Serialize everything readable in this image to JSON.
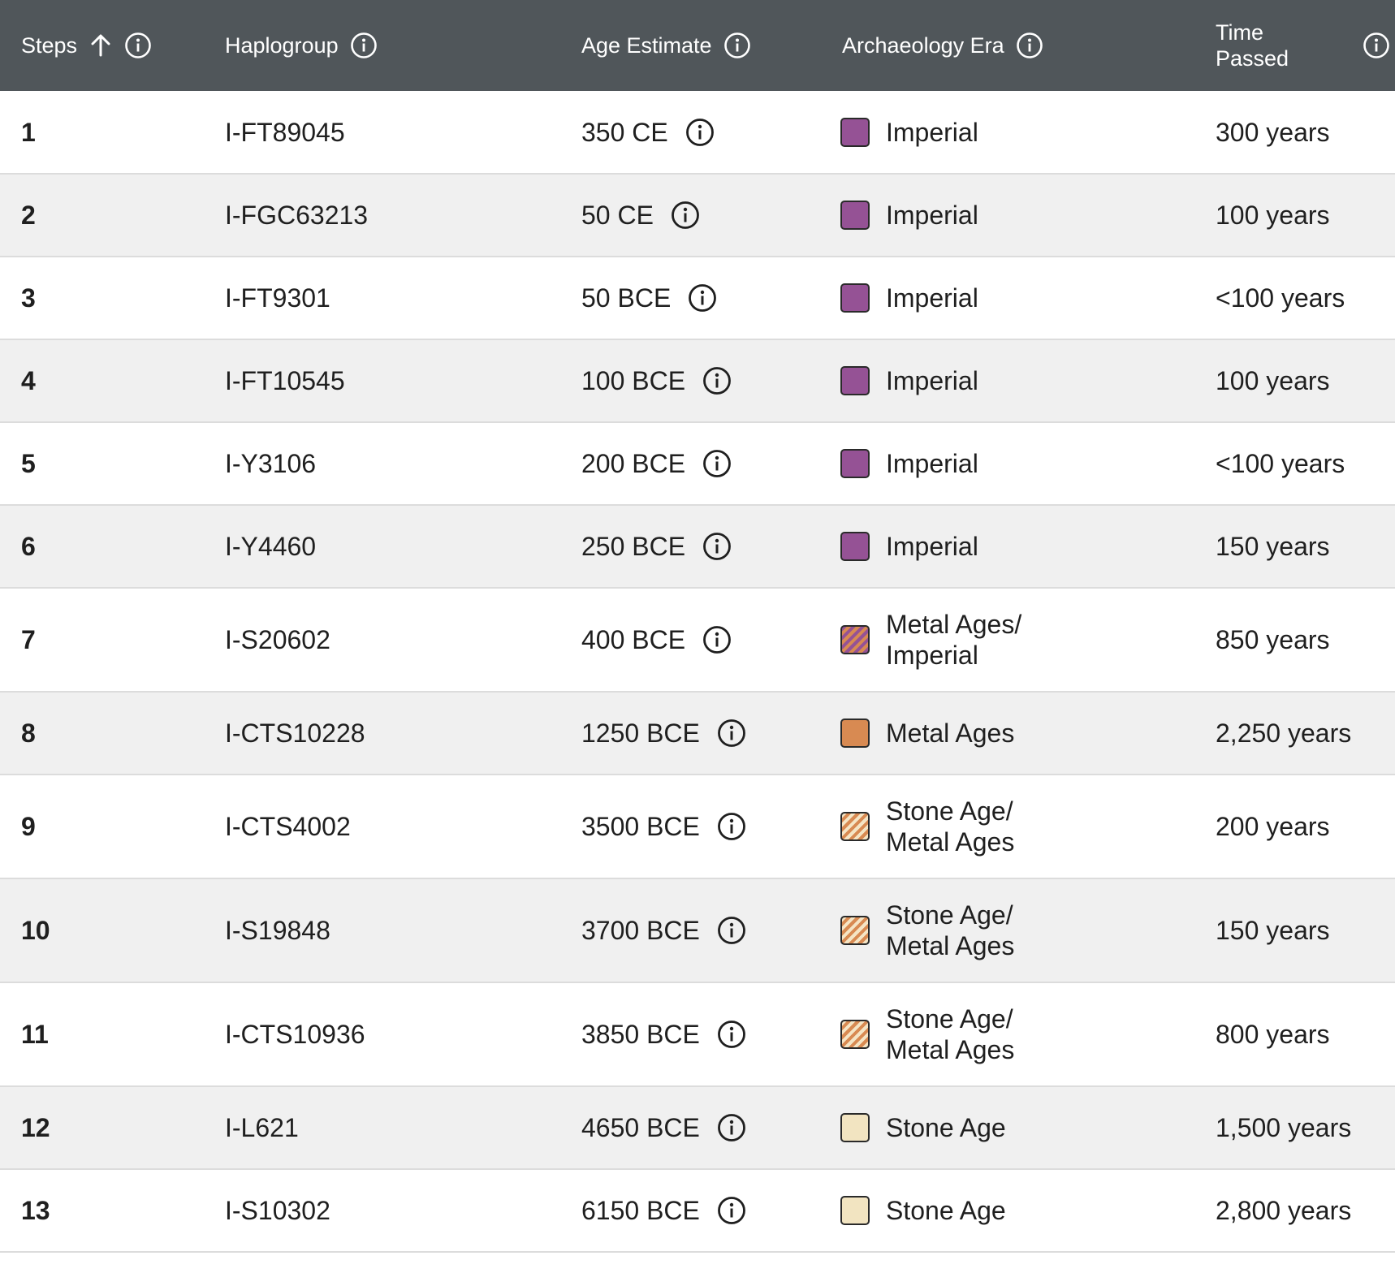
{
  "header": {
    "steps": "Steps",
    "haplogroup": "Haplogroup",
    "age_estimate": "Age Estimate",
    "archaeology_era": "Archaeology Era",
    "time_passed": "Time Passed"
  },
  "rows": [
    {
      "step": "1",
      "haplogroup": "I-FT89045",
      "age": "350 CE",
      "era": "Imperial",
      "time": "300 years"
    },
    {
      "step": "2",
      "haplogroup": "I-FGC63213",
      "age": "50 CE",
      "era": "Imperial",
      "time": "100 years"
    },
    {
      "step": "3",
      "haplogroup": "I-FT9301",
      "age": "50 BCE",
      "era": "Imperial",
      "time": "<100 years"
    },
    {
      "step": "4",
      "haplogroup": "I-FT10545",
      "age": "100 BCE",
      "era": "Imperial",
      "time": "100 years"
    },
    {
      "step": "5",
      "haplogroup": "I-Y3106",
      "age": "200 BCE",
      "era": "Imperial",
      "time": "<100 years"
    },
    {
      "step": "6",
      "haplogroup": "I-Y4460",
      "age": "250 BCE",
      "era": "Imperial",
      "time": "150 years"
    },
    {
      "step": "7",
      "haplogroup": "I-S20602",
      "age": "400 BCE",
      "era": "Metal Ages/ Imperial",
      "time": "850 years"
    },
    {
      "step": "8",
      "haplogroup": "I-CTS10228",
      "age": "1250 BCE",
      "era": "Metal Ages",
      "time": "2,250 years"
    },
    {
      "step": "9",
      "haplogroup": "I-CTS4002",
      "age": "3500 BCE",
      "era": "Stone Age/ Metal Ages",
      "time": "200 years"
    },
    {
      "step": "10",
      "haplogroup": "I-S19848",
      "age": "3700 BCE",
      "era": "Stone Age/ Metal Ages",
      "time": "150 years"
    },
    {
      "step": "11",
      "haplogroup": "I-CTS10936",
      "age": "3850 BCE",
      "era": "Stone Age/ Metal Ages",
      "time": "800 years"
    },
    {
      "step": "12",
      "haplogroup": "I-L621",
      "age": "4650 BCE",
      "era": "Stone Age",
      "time": "1,500 years"
    },
    {
      "step": "13",
      "haplogroup": "I-S10302",
      "age": "6150 BCE",
      "era": "Stone Age",
      "time": "2,800 years"
    }
  ],
  "colors": {
    "header_bg": "#50565a",
    "imperial": "#955295",
    "metal_ages": "#d88a52",
    "stone_age": "#f2e4c1"
  },
  "icons": {
    "sort": "arrow-up-icon",
    "info": "info-icon"
  }
}
